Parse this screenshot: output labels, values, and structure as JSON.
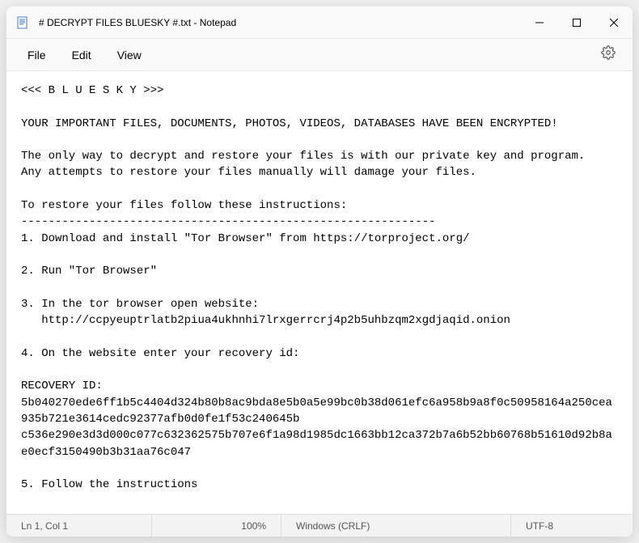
{
  "titlebar": {
    "title": "# DECRYPT FILES BLUESKY #.txt - Notepad"
  },
  "menubar": {
    "file": "File",
    "edit": "Edit",
    "view": "View"
  },
  "editor": {
    "content": "<<< B L U E S K Y >>>\n\nYOUR IMPORTANT FILES, DOCUMENTS, PHOTOS, VIDEOS, DATABASES HAVE BEEN ENCRYPTED!\n\nThe only way to decrypt and restore your files is with our private key and program.\nAny attempts to restore your files manually will damage your files.\n\nTo restore your files follow these instructions:\n-------------------------------------------------------------\n1. Download and install \"Tor Browser\" from https://torproject.org/\n\n2. Run \"Tor Browser\"\n\n3. In the tor browser open website:\n   http://ccpyeuptrlatb2piua4ukhnhi7lrxgerrcrj4p2b5uhbzqm2xgdjaqid.onion\n\n4. On the website enter your recovery id:\n\nRECOVERY ID: 5b040270ede6ff1b5c4404d324b80b8ac9bda8e5b0a5e99bc0b38d061efc6a958b9a8f0c50958164a250cea935b721e3614cedc92377afb0d0fe1f53c240645b\nc536e290e3d3d000c077c632362575b707e6f1a98d1985dc1663bb12ca372b7a6b52bb60768b51610d92b8ae0ecf3150490b3b31aa76c047\n\n5. Follow the instructions"
  },
  "statusbar": {
    "position": "Ln 1, Col 1",
    "zoom": "100%",
    "eol": "Windows (CRLF)",
    "encoding": "UTF-8"
  }
}
